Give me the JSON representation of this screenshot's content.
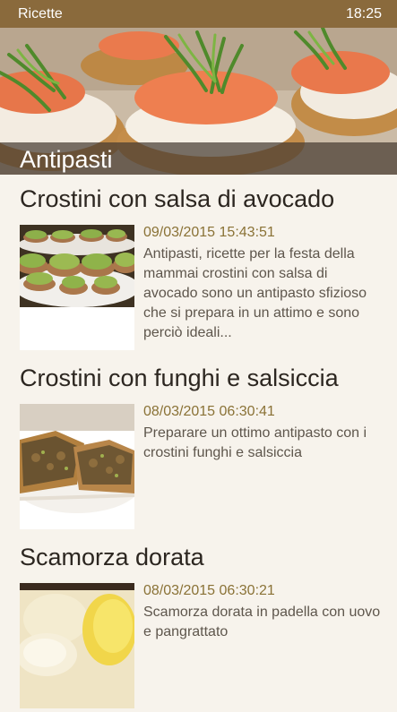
{
  "status_bar": {
    "app_name": "Ricette",
    "time": "18:25"
  },
  "section": {
    "title": "Antipasti"
  },
  "recipes": [
    {
      "title": "Crostini con salsa di avocado",
      "date": "09/03/2015 15:43:51",
      "description": "Antipasti, ricette per la festa della mammai crostini con salsa di avocado sono un antipasto sfizioso che si prepara in un attimo e sono perciò ideali..."
    },
    {
      "title": "Crostini con funghi e salsiccia",
      "date": "08/03/2015 06:30:41",
      "description": "Preparare un ottimo antipasto con i crostini funghi e salsiccia"
    },
    {
      "title": "Scamorza dorata",
      "date": "08/03/2015 06:30:21",
      "description": "Scamorza dorata in padella con uovo e pangrattato"
    }
  ],
  "colors": {
    "status_bar": "#8a6a3c",
    "background": "#f7f3ec",
    "date_text": "#8a7236",
    "title_text": "#2c2620",
    "description_text": "#5e564c"
  }
}
